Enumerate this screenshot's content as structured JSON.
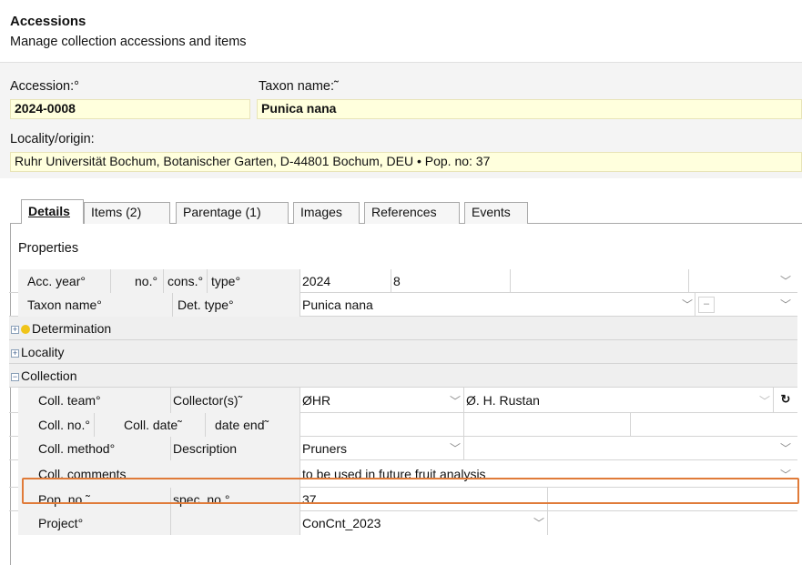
{
  "header": {
    "title": "Accessions",
    "subtitle": "Manage collection accessions and items"
  },
  "top_fields": {
    "accession_label": "Accession:°",
    "accession_value": "2024-0008",
    "taxon_label": "Taxon name:˜",
    "taxon_value": "Punica nana",
    "locality_label": "Locality/origin:",
    "locality_value": "Ruhr Universität Bochum, Botanischer Garten, D-44801 Bochum, DEU • Pop. no: 37"
  },
  "tabs": [
    {
      "label": "Details",
      "active": true
    },
    {
      "label": "Items (2)",
      "active": false
    },
    {
      "label": "Parentage (1)",
      "active": false
    },
    {
      "label": "Images",
      "active": false
    },
    {
      "label": "References",
      "active": false
    },
    {
      "label": "Events",
      "active": false
    }
  ],
  "properties": {
    "heading": "Properties",
    "rows": {
      "acc": {
        "l1": "Acc. year°",
        "l2": "no.°",
        "l3": "cons.°",
        "l4": "type°",
        "year": "2024",
        "no": "8"
      },
      "taxon": {
        "l1": "Taxon name°",
        "l2": "Det. type°",
        "value": "Punica nana",
        "dash": "–"
      },
      "determination": "Determination",
      "locality": "Locality",
      "collection": "Collection",
      "coll_team": {
        "l1": "Coll. team°",
        "l2": "Collector(s)˜",
        "team": "ØHR",
        "collector": "Ø. H. Rustan"
      },
      "coll_no": {
        "l1": "Coll. no.°",
        "l2": "Coll. date˜",
        "l3": "date end˜"
      },
      "coll_method": {
        "l1": "Coll. method°",
        "l2": "Description",
        "value": "Pruners"
      },
      "coll_comments": {
        "l1": "Coll. comments",
        "value": "to be used in future fruit analysis"
      },
      "pop_no": {
        "l1": "Pop. no.˜",
        "l2": "spec. no.°",
        "value": "37"
      },
      "project": {
        "l1": "Project°",
        "value": "ConCnt_2023"
      }
    }
  },
  "icons": {
    "dropdown": "chevron-down-icon",
    "refresh": "refresh-icon",
    "expand": "plus-expander-icon",
    "collapse": "minus-expander-icon",
    "status_dot": "yellow-status-dot"
  },
  "colors": {
    "field_bg": "#ffffdd",
    "highlight_border": "#e07b39",
    "status_dot": "#f0c419"
  }
}
